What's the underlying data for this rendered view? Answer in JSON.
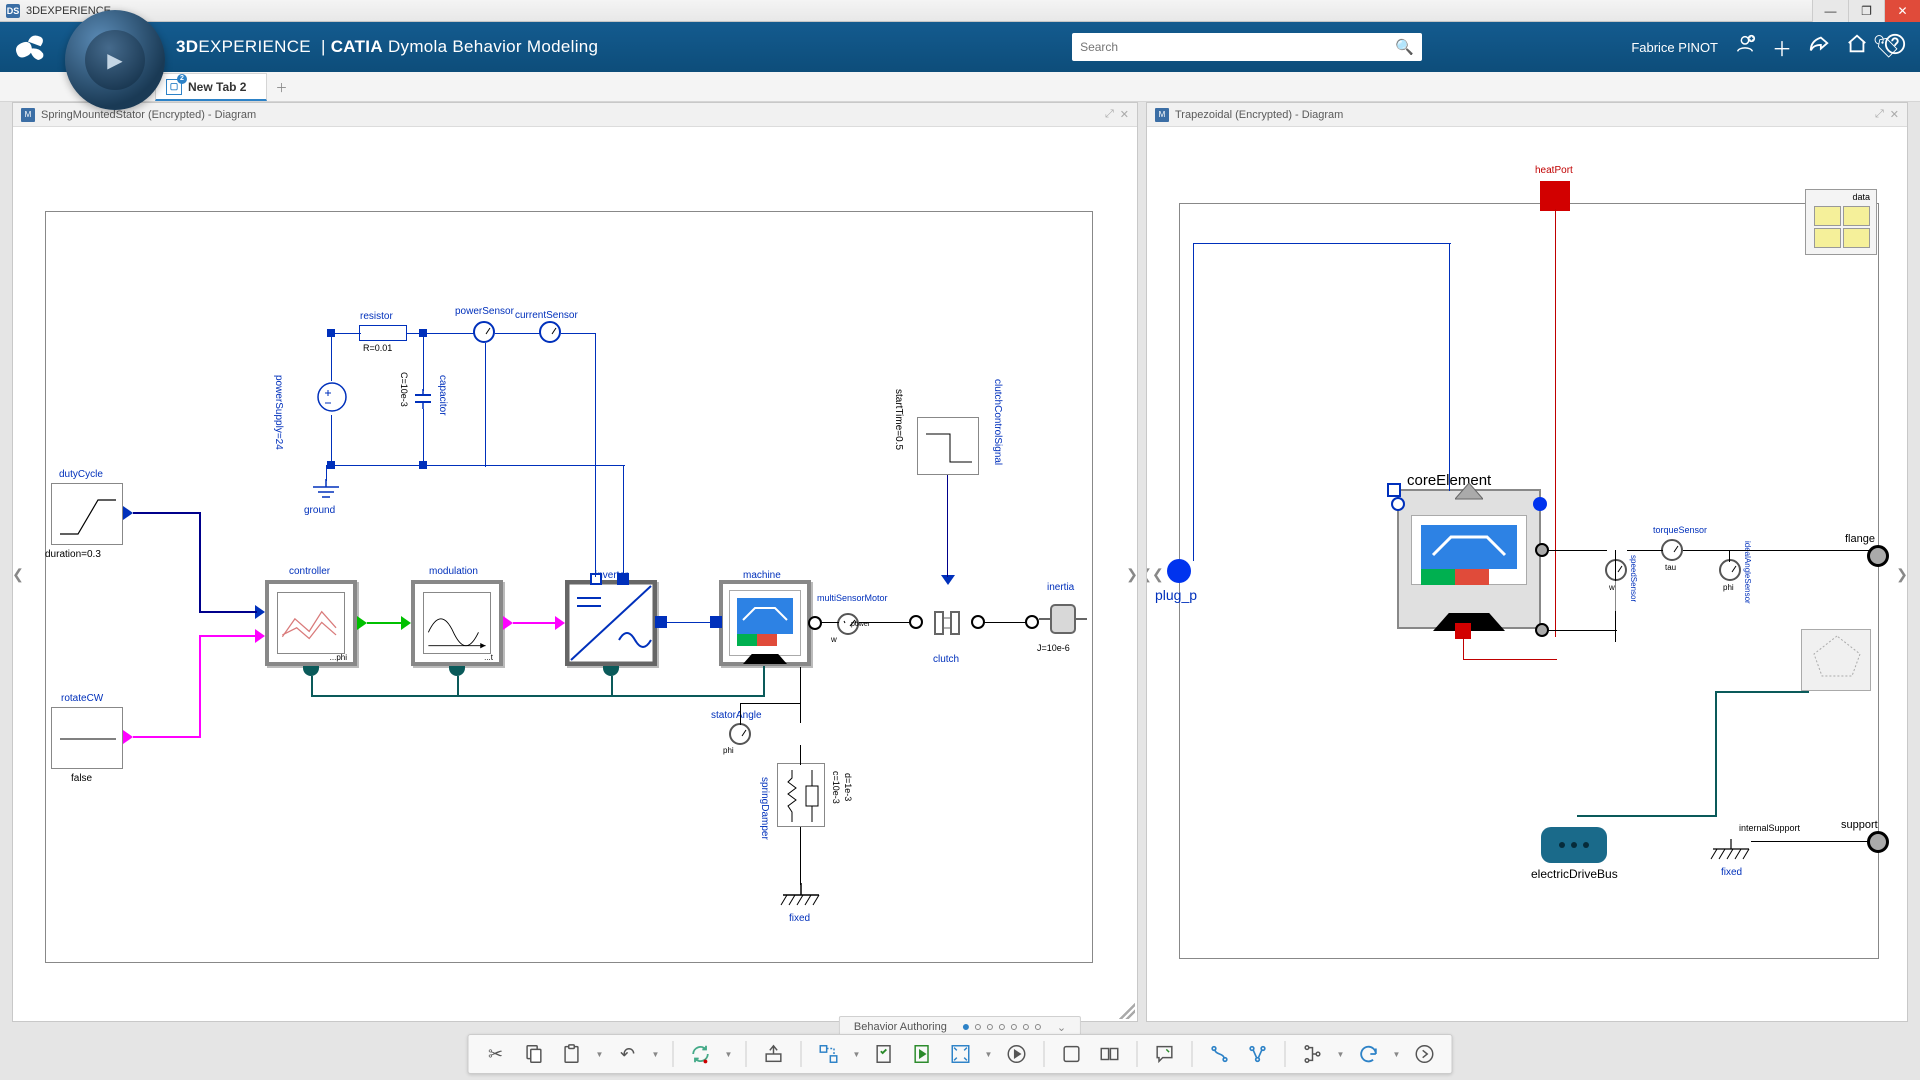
{
  "os_title": "3DEXPERIENCE",
  "brand": {
    "platform_bold": "3D",
    "platform_rest": "EXPERIENCE",
    "app": "CATIA",
    "module": "Dymola Behavior Modeling"
  },
  "search": {
    "placeholder": "Search"
  },
  "user": {
    "name": "Fabrice PINOT"
  },
  "tabs": [
    {
      "label": "New Tab 2"
    }
  ],
  "panels": {
    "left": {
      "title": "SpringMountedStator (Encrypted) - Diagram"
    },
    "right": {
      "title": "Trapezoidal (Encrypted) - Diagram"
    }
  },
  "context": {
    "label": "Behavior Authoring"
  },
  "diagram_left": {
    "dutyCycle": "dutyCycle",
    "duration": "duration=0.3",
    "rotateCW": "rotateCW",
    "false": "false",
    "controller": "controller",
    "phi": "phi",
    "modulation": "modulation",
    "t": "t",
    "inverter": "inverter",
    "machine": "machine",
    "multiSensorMotor": "multiSensorMotor",
    "w": "w",
    "power": "power",
    "clutch": "clutch",
    "clutchControlSignal": "clutchControlSignal",
    "startTime": "startTime=0.5",
    "inertia": "inertia",
    "J": "J=10e-6",
    "resistor": "resistor",
    "R": "R=0.01",
    "capacitor": "capacitor",
    "C": "C=10e-3",
    "powerSupply": "powerSupply=24",
    "ground": "ground",
    "powerSensor": "powerSensor",
    "currentSensor": "currentSensor",
    "statorAngle": "statorAngle",
    "springDamper": "springDamper",
    "c": "c=10e-3",
    "d": "d=1e-3",
    "fixed": "fixed"
  },
  "diagram_right": {
    "heatPort": "heatPort",
    "data": "data",
    "coreElement": "coreElement",
    "plug_p": "plug_p",
    "torqueSensor": "torqueSensor",
    "tau": "tau",
    "speedSensor": "speedSensor",
    "w": "w",
    "idealAngleSensor": "idealAngleSensor",
    "phi": "phi",
    "flange": "flange",
    "support": "support",
    "electricDriveBus": "electricDriveBus",
    "internalSupport": "internalSupport",
    "fixed": "fixed"
  }
}
